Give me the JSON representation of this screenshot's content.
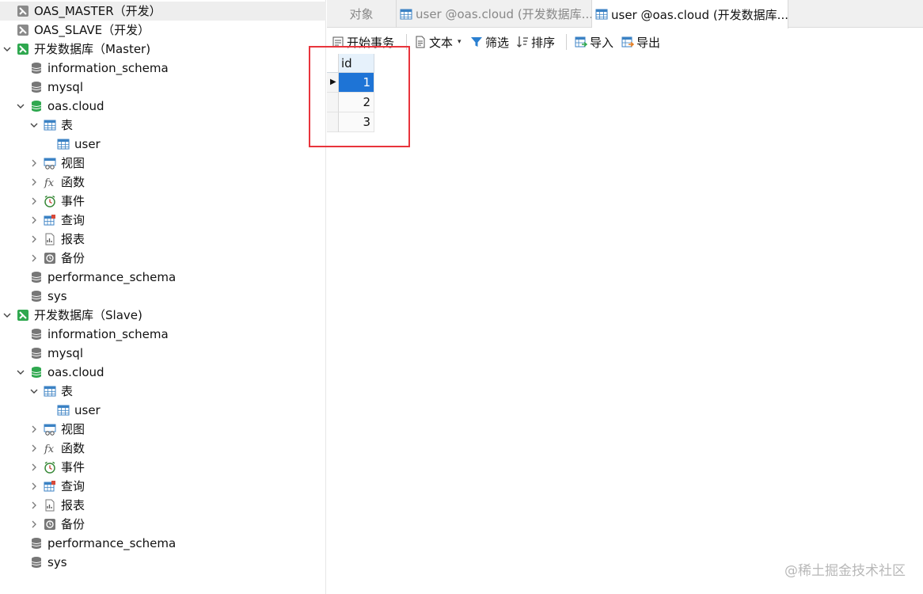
{
  "sidebar": {
    "items": [
      {
        "label": "OAS_MASTER（开发）",
        "icon": "connection-icon"
      },
      {
        "label": "OAS_SLAVE（开发）",
        "icon": "connection-icon"
      },
      {
        "label": "开发数据库（Master)",
        "icon": "mysql-connection-icon"
      },
      {
        "label": "information_schema",
        "icon": "database-icon"
      },
      {
        "label": "mysql",
        "icon": "database-icon"
      },
      {
        "label": "oas.cloud",
        "icon": "database-open-icon"
      },
      {
        "label": "表",
        "icon": "table-folder-icon"
      },
      {
        "label": "user",
        "icon": "table-icon"
      },
      {
        "label": "视图",
        "icon": "view-icon"
      },
      {
        "label": "函数",
        "icon": "function-icon"
      },
      {
        "label": "事件",
        "icon": "event-icon"
      },
      {
        "label": "查询",
        "icon": "query-icon"
      },
      {
        "label": "报表",
        "icon": "report-icon"
      },
      {
        "label": "备份",
        "icon": "backup-icon"
      },
      {
        "label": "performance_schema",
        "icon": "database-icon"
      },
      {
        "label": "sys",
        "icon": "database-icon"
      },
      {
        "label": "开发数据库（Slave)",
        "icon": "mysql-connection-icon"
      },
      {
        "label": "information_schema",
        "icon": "database-icon"
      },
      {
        "label": "mysql",
        "icon": "database-icon"
      },
      {
        "label": "oas.cloud",
        "icon": "database-open-icon"
      },
      {
        "label": "表",
        "icon": "table-folder-icon"
      },
      {
        "label": "user",
        "icon": "table-icon"
      },
      {
        "label": "视图",
        "icon": "view-icon"
      },
      {
        "label": "函数",
        "icon": "function-icon"
      },
      {
        "label": "事件",
        "icon": "event-icon"
      },
      {
        "label": "查询",
        "icon": "query-icon"
      },
      {
        "label": "报表",
        "icon": "report-icon"
      },
      {
        "label": "备份",
        "icon": "backup-icon"
      },
      {
        "label": "performance_schema",
        "icon": "database-icon"
      },
      {
        "label": "sys",
        "icon": "database-icon"
      }
    ]
  },
  "tabs": [
    {
      "label": "对象"
    },
    {
      "label": "user @oas.cloud (开发数据库..."
    },
    {
      "label": "user @oas.cloud (开发数据库..."
    }
  ],
  "toolbar": {
    "begin_transaction": "开始事务",
    "text": "文本",
    "filter": "筛选",
    "sort": "排序",
    "import": "导入",
    "export": "导出"
  },
  "grid": {
    "columns": [
      "id"
    ],
    "rows": [
      [
        "1"
      ],
      [
        "2"
      ],
      [
        "3"
      ]
    ]
  },
  "colors": {
    "selected_cell": "#1e74d6",
    "highlight_box": "#e8343c",
    "db_green": "#2fa84f"
  },
  "watermark": "@稀土掘金技术社区"
}
